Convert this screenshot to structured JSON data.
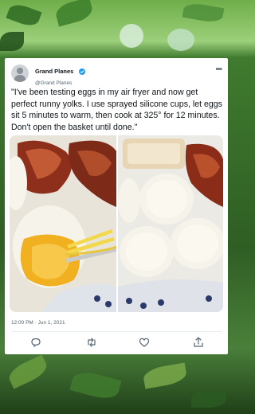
{
  "post": {
    "display_name": "Grand Planes",
    "handle": "@Grand Planes",
    "text": "\"I've been testing eggs in my air fryer and now get perfect runny yolks. I use sprayed silicone cups, let eggs sit 5 minutes to warm, then cook at 325° for 12 minutes. Don't open the basket until done.\"",
    "timestamp": "12:00 PM · Jun 1, 2021",
    "more_label": "•••"
  },
  "colors": {
    "verified": "#1d9bf0",
    "text": "#0f1419",
    "secondary": "#536471",
    "egg_white": "#f6f3ea",
    "yolk": "#f0b020",
    "bacon": "#9b3a22"
  },
  "icons": [
    "verified-badge-icon",
    "reply-icon",
    "retweet-icon",
    "like-icon",
    "share-icon",
    "more-icon"
  ]
}
